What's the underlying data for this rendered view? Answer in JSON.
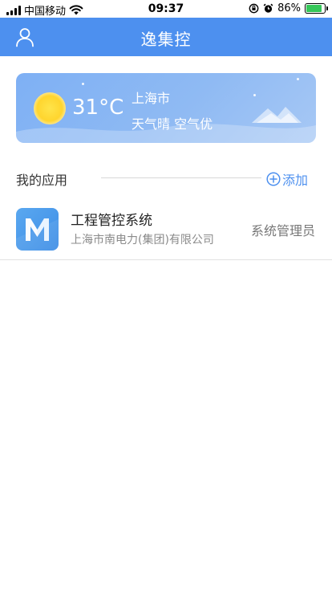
{
  "status_bar": {
    "carrier": "中国移动",
    "time": "09:37",
    "battery_percent": "86%",
    "battery_level": 0.86,
    "icons": [
      "signal-icon",
      "wifi-icon",
      "orientation-lock-icon",
      "alarm-icon",
      "battery-icon"
    ]
  },
  "header": {
    "title": "逸集控",
    "left_icon": "user-icon",
    "color": "#4d90ef"
  },
  "weather": {
    "temperature": "31°C",
    "city": "上海市",
    "description": "天气晴 空气优",
    "icon": "sun-icon"
  },
  "apps_section": {
    "title": "我的应用",
    "add_label": "添加",
    "add_icon": "plus-circle-icon",
    "items": [
      {
        "name": "工程管控系统",
        "company": "上海市南电力(集团)有限公司",
        "role": "系统管理员",
        "icon_letter": "M"
      }
    ]
  }
}
